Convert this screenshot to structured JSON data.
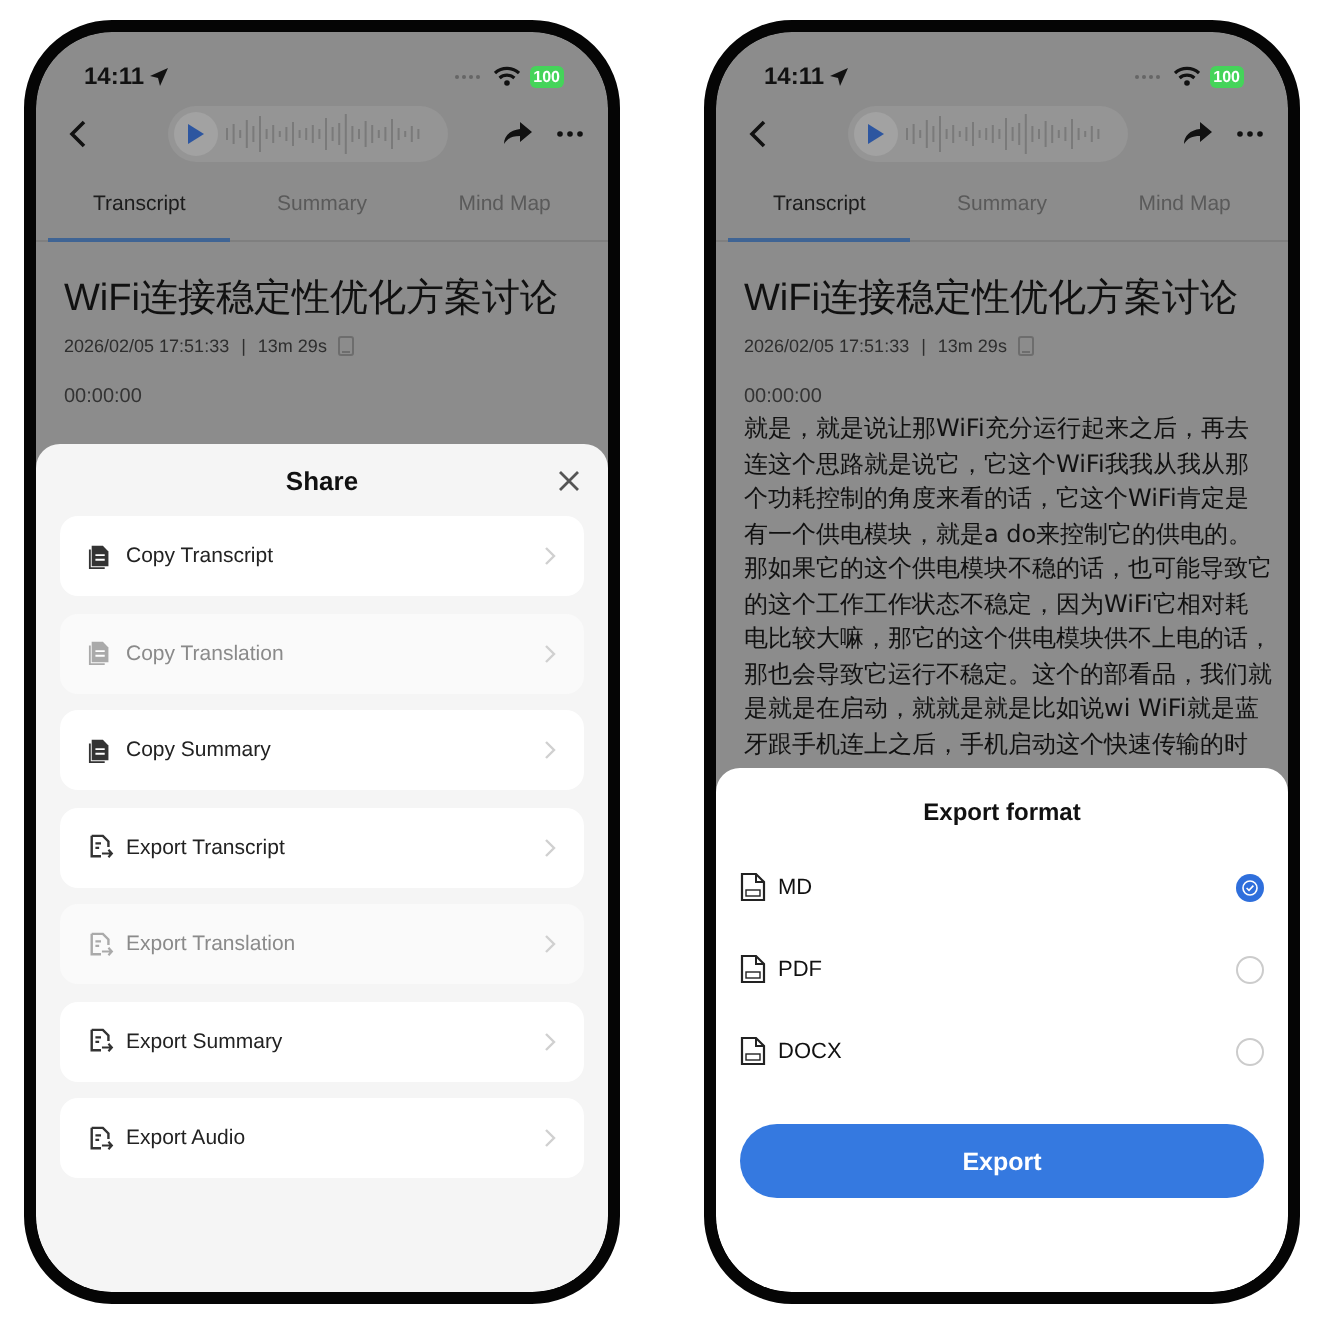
{
  "phones": [
    {
      "status_bar": {
        "time": "14:11",
        "battery": "100"
      },
      "tabs": [
        {
          "label": "Transcript",
          "selected": true
        },
        {
          "label": "Summary",
          "selected": false
        },
        {
          "label": "Mind Map",
          "selected": false
        }
      ],
      "title": "WiFi连接稳定性优化方案讨论",
      "date": "2026/02/05 17:51:33",
      "separator": "|",
      "duration": "13m 29s",
      "timestamp": "00:00:00",
      "sheet": {
        "kind": "share",
        "title": "Share",
        "items": [
          {
            "label": "Copy Transcript",
            "kind": "copy",
            "disabled": false
          },
          {
            "label": "Copy Translation",
            "kind": "copy",
            "disabled": true
          },
          {
            "label": "Copy Summary",
            "kind": "copy",
            "disabled": false
          },
          {
            "label": "Export Transcript",
            "kind": "export",
            "disabled": false
          },
          {
            "label": "Export Translation",
            "kind": "export",
            "disabled": true
          },
          {
            "label": "Export Summary",
            "kind": "export",
            "disabled": false
          },
          {
            "label": "Export Audio",
            "kind": "export",
            "disabled": false
          }
        ]
      }
    },
    {
      "status_bar": {
        "time": "14:11",
        "battery": "100"
      },
      "tabs": [
        {
          "label": "Transcript",
          "selected": true
        },
        {
          "label": "Summary",
          "selected": false
        },
        {
          "label": "Mind Map",
          "selected": false
        }
      ],
      "title": "WiFi连接稳定性优化方案讨论",
      "date": "2026/02/05 17:51:33",
      "separator": "|",
      "duration": "13m 29s",
      "timestamp": "00:00:00",
      "body_lines": [
        "就是，就是说让那WiFi充分运行起来之后，再去",
        "连这个思路就是说它，它这个WiFi我我从我从那",
        "个功耗控制的角度来看的话，它这个WiFi肯定是",
        "有一个供电模块，就是a do来控制它的供电的。",
        "那如果它的这个供电模块不稳的话，也可能导致它",
        "的这个工作工作状态不稳定，因为WiFi它相对耗",
        "电比较大嘛，那它的这个供电模块供不上电的话，",
        "那也会导致它运行不稳定。这个的部看品，我们就",
        "是就是在启动，就就是就是比如说wi WiFi就是蓝",
        "牙跟手机连上之后，手机启动这个快速传输的时"
      ],
      "sheet": {
        "kind": "export",
        "title": "Export format",
        "options": [
          {
            "label": "MD",
            "selected": true
          },
          {
            "label": "PDF",
            "selected": false
          },
          {
            "label": "DOCX",
            "selected": false
          }
        ],
        "button": "Export"
      }
    }
  ]
}
